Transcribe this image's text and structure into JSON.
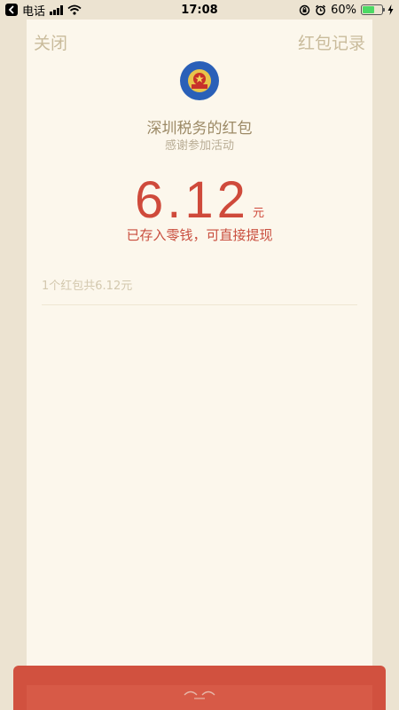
{
  "status_bar": {
    "carrier": "电话",
    "time": "17:08",
    "battery_percent": "60%",
    "battery_level": 0.6
  },
  "nav": {
    "close_label": "关闭",
    "records_label": "红包记录"
  },
  "packet": {
    "sender": "深圳税务的红包",
    "wish": "感谢参加活动",
    "amount": "6.12",
    "currency": "元",
    "stored_notice": "已存入零钱，可直接提现",
    "summary": "1个红包共6.12元"
  },
  "colors": {
    "accent_red": "#cf4a3b",
    "card_background": "#fcf7ec",
    "page_background": "#ece3d1",
    "nav_text": "#c9bb9b"
  }
}
